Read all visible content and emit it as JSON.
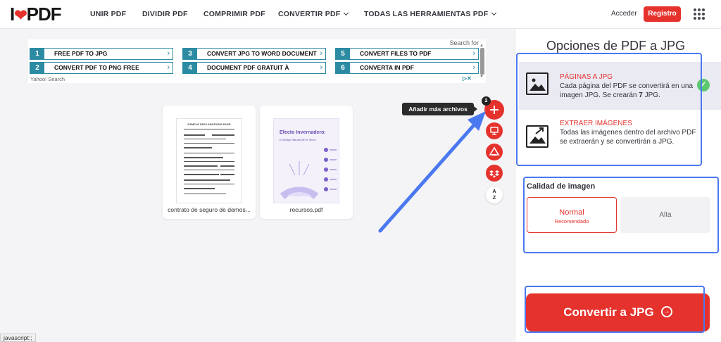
{
  "header": {
    "logo_prefix": "I",
    "logo_suffix": "PDF",
    "nav": [
      {
        "label": "UNIR PDF",
        "dropdown": false
      },
      {
        "label": "DIVIDIR PDF",
        "dropdown": false
      },
      {
        "label": "COMPRIMIR PDF",
        "dropdown": false
      },
      {
        "label": "CONVERTIR PDF",
        "dropdown": true
      },
      {
        "label": "TODAS LAS HERRAMIENTAS PDF",
        "dropdown": true
      }
    ],
    "login_label": "Acceder",
    "register_label": "Registro"
  },
  "ad": {
    "search_for": "Search for",
    "footer": "Yahoo! Search",
    "links": [
      {
        "num": "1",
        "text": "FREE PDF TO JPG"
      },
      {
        "num": "2",
        "text": "CONVERT PDF TO PNG FREE"
      },
      {
        "num": "3",
        "text": "CONVERT JPG TO WORD DOCUMENT"
      },
      {
        "num": "4",
        "text": "DOCUMENT PDF GRATUIT À"
      },
      {
        "num": "5",
        "text": "CONVERT FILES TO PDF"
      },
      {
        "num": "6",
        "text": "CONVERTA IN PDF"
      }
    ]
  },
  "files": [
    {
      "name": "contrato de seguro de demos...",
      "thumb_heading": "SAMPLE DECLARATIONS PAGE"
    },
    {
      "name": "recursos.pdf",
      "thumb_heading": "Efecto Invernadero:",
      "thumb_sub": "El Abrigo Natural de la Tierra"
    }
  ],
  "tools": {
    "add_tooltip": "Añadir más archivos",
    "file_count": "2",
    "sort_label_top": "A",
    "sort_label_bottom": "Z"
  },
  "sidebar": {
    "title": "Opciones de PDF a JPG",
    "options": [
      {
        "title": "PÁGINAS A JPG",
        "desc_before": "Cada página del PDF se convertirá en una imagen JPG. Se crearán ",
        "desc_count": "7",
        "desc_after": " JPG.",
        "selected": true
      },
      {
        "title": "EXTRAER IMÁGENES",
        "desc": "Todas las imágenes dentro del archivo PDF se extraerán y se convertirán a JPG.",
        "selected": false
      }
    ],
    "quality": {
      "title": "Calidad de imagen",
      "normal_label": "Normal",
      "normal_sub": "Recomendado",
      "high_label": "Alta"
    },
    "convert_label": "Convertir a JPG"
  },
  "status_text": "javascript:;",
  "colors": {
    "brand_red": "#e5322d",
    "annotation_blue": "#4a78f0",
    "check_green": "#5dc770",
    "ad_teal": "#2c8ba3"
  }
}
